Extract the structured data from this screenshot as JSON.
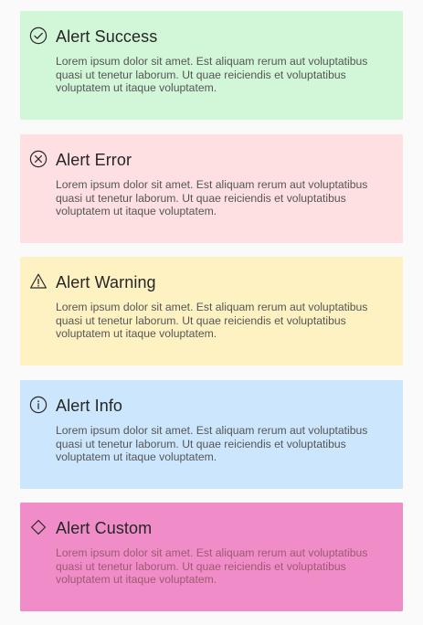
{
  "alerts": [
    {
      "id": "success",
      "title": "Alert Success",
      "icon": "check-circle-icon",
      "background": "#d2f6d8",
      "description": "Lorem ipsum dolor sit amet. Est aliquam rerum aut voluptatibus quasi ut tenetur laborum. Ut quae reiciendis et voluptatibus voluptatem ut itaque voluptatem."
    },
    {
      "id": "error",
      "title": "Alert Error",
      "icon": "x-circle-icon",
      "background": "#fee0e2",
      "description": "Lorem ipsum dolor sit amet. Est aliquam rerum aut voluptatibus quasi ut tenetur laborum. Ut quae reiciendis et voluptatibus voluptatem ut itaque voluptatem."
    },
    {
      "id": "warning",
      "title": "Alert Warning",
      "icon": "warning-triangle-icon",
      "background": "#fff2c2",
      "description": "Lorem ipsum dolor sit amet. Est aliquam rerum aut voluptatibus quasi ut tenetur laborum. Ut quae reiciendis et voluptatibus voluptatem ut itaque voluptatem."
    },
    {
      "id": "info",
      "title": "Alert Info",
      "icon": "info-circle-icon",
      "background": "#cce7fd",
      "description": "Lorem ipsum dolor sit amet. Est aliquam rerum aut voluptatibus quasi ut tenetur laborum. Ut quae reiciendis et voluptatibus voluptatem ut itaque voluptatem."
    },
    {
      "id": "custom",
      "title": "Alert Custom",
      "icon": "diamond-icon",
      "background": "#f08dc8",
      "description_color": "#9c5a70",
      "description": "Lorem ipsum dolor sit amet. Est aliquam rerum aut voluptatibus quasi ut tenetur laborum. Ut quae reiciendis et voluptatibus voluptatem ut itaque voluptatem."
    }
  ]
}
